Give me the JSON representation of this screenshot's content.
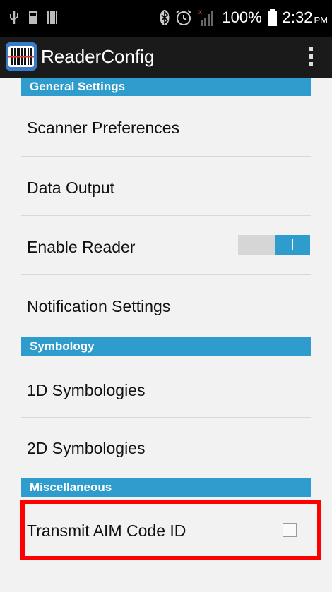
{
  "status_bar": {
    "battery_percent": "100%",
    "time": "2:32",
    "ampm": "PM",
    "icons": [
      "usb-icon",
      "sd-card-icon",
      "barcode-notification-icon",
      "bluetooth-icon",
      "alarm-icon",
      "signal-icon",
      "battery-icon"
    ]
  },
  "action_bar": {
    "title": "ReaderConfig",
    "app_icon": "barcode-scanner-icon",
    "overflow_icon": "overflow-menu-icon"
  },
  "sections": {
    "general": "General Settings",
    "symbology": "Symbology",
    "misc": "Miscellaneous"
  },
  "items": {
    "scanner_preferences": "Scanner Preferences",
    "data_output": "Data Output",
    "enable_reader": "Enable Reader",
    "notification_settings": "Notification Settings",
    "symbologies_1d": "1D Symbologies",
    "symbologies_2d": "2D Symbologies",
    "transmit_aim": "Transmit AIM Code ID"
  },
  "states": {
    "enable_reader_on": true,
    "transmit_aim_checked": false
  },
  "colors": {
    "accent": "#2e9ccd",
    "highlight": "#ff0000"
  }
}
